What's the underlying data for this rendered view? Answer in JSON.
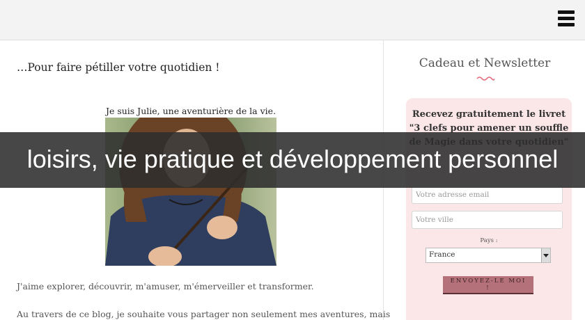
{
  "header": {
    "menu_icon": "hamburger-menu-icon"
  },
  "main": {
    "title": "…Pour faire pétiller votre quotidien !",
    "caption": "Je suis Julie, une aventurière de la vie.",
    "paragraph_1": "J'aime explorer, découvrir, m'amuser, m'émerveiller et transformer.",
    "paragraph_2": "Au travers de ce blog, je souhaite vous partager non seulement mes aventures, mais"
  },
  "sidebar": {
    "title": "Cadeau et Newsletter",
    "offer_text": "Recevez gratuitement le livret \"3 clefs pour amener un souffle de Magie dans votre quotidien\"",
    "email_placeholder": "Votre adresse email",
    "city_placeholder": "Votre ville",
    "country_label": "Pays :",
    "country_value": "France",
    "submit_label": "ENVOYEZ-LE MOI !"
  },
  "overlay": {
    "text": "loisirs, vie pratique et développement personnel"
  },
  "colors": {
    "topbar": "#f3f3f3",
    "newsletter_bg": "#fbe6e8",
    "accent": "#e5697a",
    "button": "#b5717a",
    "overlay": "#2d2d2d"
  }
}
